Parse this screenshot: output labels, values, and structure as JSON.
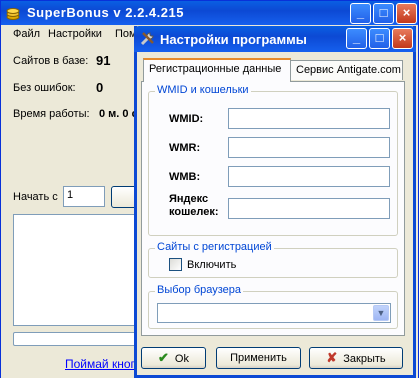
{
  "main_window": {
    "title": "SuperBonus v 2.2.4.215",
    "menu": [
      "Файл",
      "Настройки",
      "Пом"
    ],
    "stats": {
      "sites_label": "Сайтов в базе:",
      "sites_value": "91",
      "errors_label": "Без ошибок:",
      "errors_value": "0",
      "uptime_label": "Время работы:",
      "uptime_value": "0 м. 0 с"
    },
    "start_label": "Начать с",
    "start_value": "1",
    "link_text": "Поймай кноп"
  },
  "dialog": {
    "title": "Настройки программы",
    "tabs": [
      "Регистрационные данные",
      "Сервис Antigate.com"
    ],
    "wmid_group": {
      "title": "WMID и кошельки",
      "fields": [
        {
          "label": "WMID:",
          "value": ""
        },
        {
          "label": "WMR:",
          "value": ""
        },
        {
          "label": "WMB:",
          "value": ""
        },
        {
          "label_line1": "Яндекс",
          "label_line2": "кошелек:",
          "value": ""
        }
      ]
    },
    "reg_group": {
      "title": "Сайты с регистрацией",
      "checkbox_label": "Включить",
      "checked": false
    },
    "browser_group": {
      "title": "Выбор браузера",
      "selected": ""
    },
    "buttons": {
      "ok": "Ok",
      "apply": "Применить",
      "close": "Закрыть"
    }
  },
  "colors": {
    "titlebar": "#0c49d4",
    "group_title": "#0046d5",
    "ok_check": "#2a8a1e",
    "close_x": "#c0392b"
  }
}
